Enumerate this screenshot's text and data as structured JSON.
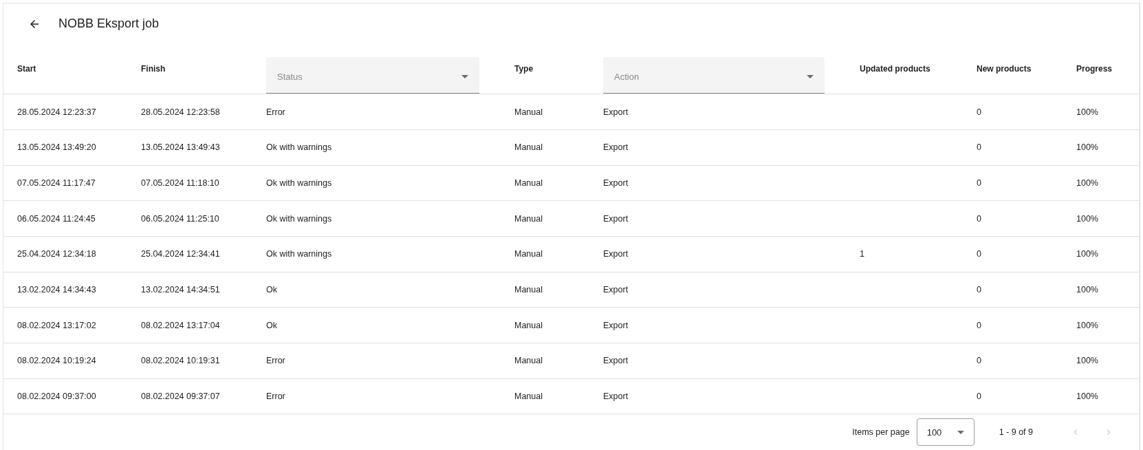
{
  "header": {
    "title": "NOBB Eksport job"
  },
  "table": {
    "columns": [
      {
        "kind": "text",
        "label": "Start"
      },
      {
        "kind": "text",
        "label": "Finish"
      },
      {
        "kind": "select",
        "placeholder": "Status"
      },
      {
        "kind": "text",
        "label": "Type"
      },
      {
        "kind": "select",
        "placeholder": "Action"
      },
      {
        "kind": "text",
        "label": "Updated products"
      },
      {
        "kind": "text",
        "label": "New products"
      },
      {
        "kind": "text",
        "label": "Progress"
      }
    ],
    "rows": [
      {
        "cells": [
          "28.05.2024 12:23:37",
          "28.05.2024 12:23:58",
          "Error",
          "Manual",
          "Export",
          "",
          "0",
          "100%"
        ]
      },
      {
        "cells": [
          "13.05.2024 13:49:20",
          "13.05.2024 13:49:43",
          "Ok with warnings",
          "Manual",
          "Export",
          "",
          "0",
          "100%"
        ]
      },
      {
        "cells": [
          "07.05.2024 11:17:47",
          "07.05.2024 11:18:10",
          "Ok with warnings",
          "Manual",
          "Export",
          "",
          "0",
          "100%"
        ]
      },
      {
        "cells": [
          "06.05.2024 11:24:45",
          "06.05.2024 11:25:10",
          "Ok with warnings",
          "Manual",
          "Export",
          "",
          "0",
          "100%"
        ]
      },
      {
        "cells": [
          "25.04.2024 12:34:18",
          "25.04.2024 12:34:41",
          "Ok with warnings",
          "Manual",
          "Export",
          "1",
          "0",
          "100%"
        ]
      },
      {
        "cells": [
          "13.02.2024 14:34:43",
          "13.02.2024 14:34:51",
          "Ok",
          "Manual",
          "Export",
          "",
          "0",
          "100%"
        ]
      },
      {
        "cells": [
          "08.02.2024 13:17:02",
          "08.02.2024 13:17:04",
          "Ok",
          "Manual",
          "Export",
          "",
          "0",
          "100%"
        ]
      },
      {
        "cells": [
          "08.02.2024 10:19:24",
          "08.02.2024 10:19:31",
          "Error",
          "Manual",
          "Export",
          "",
          "0",
          "100%"
        ]
      },
      {
        "cells": [
          "08.02.2024 09:37:00",
          "08.02.2024 09:37:07",
          "Error",
          "Manual",
          "Export",
          "",
          "0",
          "100%"
        ]
      }
    ]
  },
  "paginator": {
    "label": "Items per page",
    "page_size": "100",
    "range": "1 - 9 of 9",
    "previous_disabled": true,
    "next_disabled": true
  }
}
